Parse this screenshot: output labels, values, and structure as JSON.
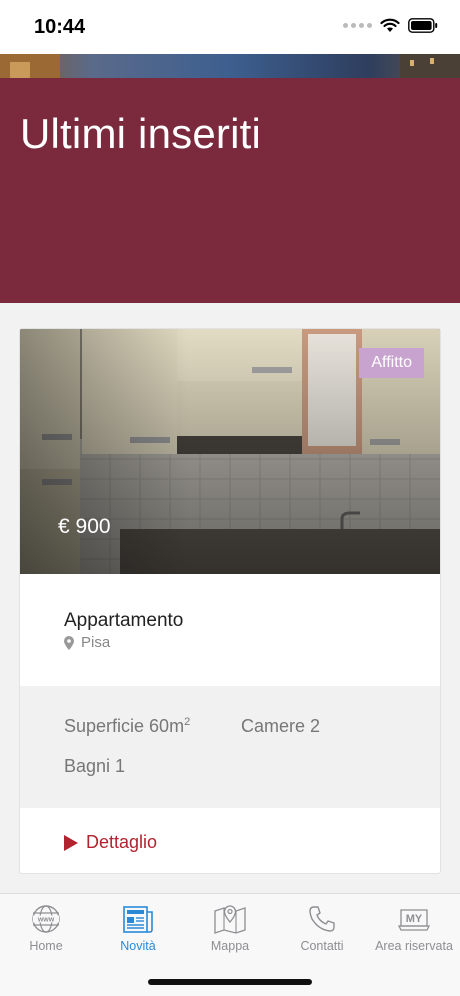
{
  "status_bar": {
    "time": "10:44"
  },
  "header": {
    "title": "Ultimi inseriti"
  },
  "listing": {
    "badge": "Affitto",
    "price": "€ 900",
    "type": "Appartamento",
    "location": "Pisa",
    "features": {
      "surface_label": "Superficie 60m",
      "surface_sup": "2",
      "rooms": "Camere 2",
      "bathrooms": "Bagni 1"
    },
    "detail_label": "Dettaglio"
  },
  "tabs": [
    {
      "label": "Home",
      "icon": "globe-www-icon",
      "active": false
    },
    {
      "label": "Novità",
      "icon": "newspaper-icon",
      "active": true
    },
    {
      "label": "Mappa",
      "icon": "map-pin-icon",
      "active": false
    },
    {
      "label": "Contatti",
      "icon": "phone-icon",
      "active": false
    },
    {
      "label": "Area riservata",
      "icon": "my-area-icon",
      "active": false
    }
  ],
  "colors": {
    "banner": "#7a2a3c",
    "accent_red": "#b0232f",
    "badge": "#c9a3cf",
    "tab_active": "#2a8ad8",
    "tab_inactive": "#8e8e93"
  }
}
